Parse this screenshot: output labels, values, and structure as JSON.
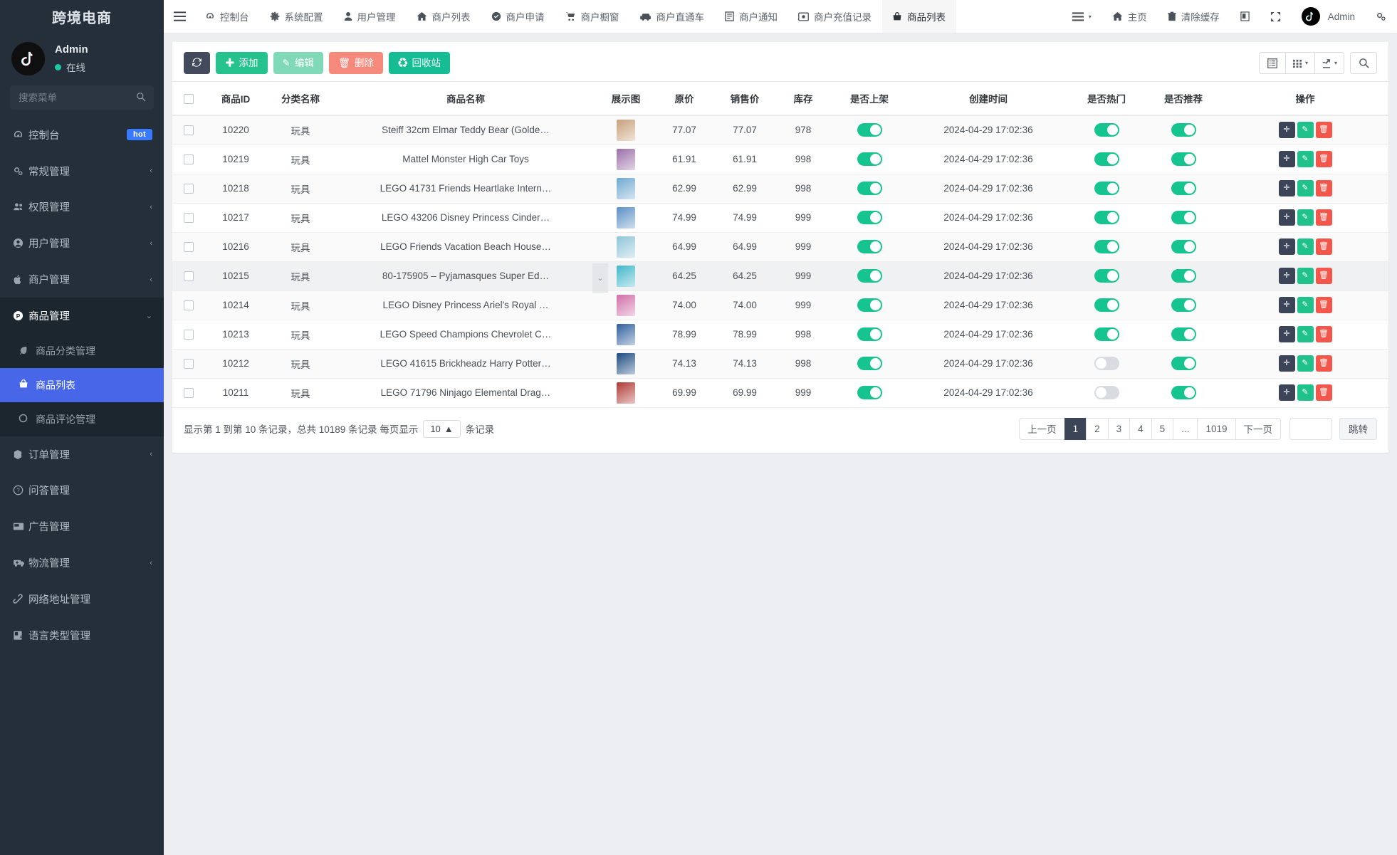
{
  "sidebar": {
    "brand": "跨境电商",
    "user": {
      "name": "Admin",
      "status": "在线",
      "avatar_icon": "tiktok-logo-icon"
    },
    "search": {
      "placeholder": "搜索菜单",
      "value": "",
      "icon": "search-icon"
    },
    "items": [
      {
        "label": "控制台",
        "icon": "dashboard-icon",
        "badge": "hot"
      },
      {
        "label": "常规管理",
        "icon": "cogs-icon",
        "arrow": "‹"
      },
      {
        "label": "权限管理",
        "icon": "users-icon",
        "arrow": "‹"
      },
      {
        "label": "用户管理",
        "icon": "user-circle-icon",
        "arrow": "‹"
      },
      {
        "label": "商户管理",
        "icon": "apple-icon",
        "arrow": "‹"
      },
      {
        "label": "商品管理",
        "icon": "product-icon",
        "arrow": "⌄"
      }
    ],
    "submenu": [
      {
        "label": "商品分类管理",
        "icon": "leaf-icon"
      },
      {
        "label": "商品列表",
        "icon": "bag-icon"
      },
      {
        "label": "商品评论管理",
        "icon": "circle-icon"
      }
    ],
    "items_after": [
      {
        "label": "订单管理",
        "icon": "cube-icon",
        "arrow": "‹"
      },
      {
        "label": "问答管理",
        "icon": "question-icon"
      },
      {
        "label": "广告管理",
        "icon": "ad-icon"
      },
      {
        "label": "物流管理",
        "icon": "truck-icon",
        "arrow": "‹"
      },
      {
        "label": "网络地址管理",
        "icon": "link-icon"
      },
      {
        "label": "语言类型管理",
        "icon": "language-icon"
      }
    ]
  },
  "topbar": {
    "hamburger_icon": "menu-icon",
    "tabs": [
      {
        "label": "控制台",
        "icon": "dashboard-icon"
      },
      {
        "label": "系统配置",
        "icon": "gear-icon"
      },
      {
        "label": "用户管理",
        "icon": "user-icon"
      },
      {
        "label": "商户列表",
        "icon": "home-icon"
      },
      {
        "label": "商户申请",
        "icon": "check-circle-icon"
      },
      {
        "label": "商户橱窗",
        "icon": "cart-icon"
      },
      {
        "label": "商户直通车",
        "icon": "car-icon"
      },
      {
        "label": "商户通知",
        "icon": "note-icon"
      },
      {
        "label": "商户充值记录",
        "icon": "money-icon"
      },
      {
        "label": "商品列表",
        "icon": "bag-icon"
      }
    ],
    "active_tab": "商品列表",
    "right": {
      "menu_label": "",
      "menu_icon": "list-icon",
      "home_label": "主页",
      "home_icon": "home-icon",
      "clear_cache_label": "清除缓存",
      "clear_cache_icon": "trash-icon",
      "note_icon": "clipboard-icon",
      "fullscreen_icon": "expand-icon",
      "admin_label": "Admin",
      "admin_avatar_icon": "tiktok-logo-icon",
      "settings_icon": "cogs-icon"
    }
  },
  "toolbar": {
    "refresh_icon": "refresh-icon",
    "refresh_label": "",
    "add_label": "添加",
    "add_icon": "plus-icon",
    "edit_label": "编辑",
    "edit_icon": "pencil-icon",
    "delete_label": "删除",
    "delete_icon": "trash-icon",
    "recycle_label": "回收站",
    "recycle_icon": "recycle-icon",
    "columns_icon": "columns-icon",
    "grid_icon": "grid-icon",
    "export_icon": "export-icon",
    "search_icon": "search-icon"
  },
  "table": {
    "columns": [
      "",
      "商品ID",
      "分类名称",
      "商品名称",
      "展示图",
      "原价",
      "销售价",
      "库存",
      "是否上架",
      "创建时间",
      "是否热门",
      "是否推荐",
      "操作"
    ],
    "rows": [
      {
        "id": "10220",
        "category": "玩具",
        "name": "Steiff 32cm Elmar Teddy Bear (Golde…",
        "price": "77.07",
        "sale_price": "77.07",
        "stock": "978",
        "on_shelf": true,
        "created": "2024-04-29 17:02:36",
        "hot": true,
        "recommend": true,
        "hovered": false,
        "thumb_color": "#c8a07a"
      },
      {
        "id": "10219",
        "category": "玩具",
        "name": "Mattel Monster High Car Toys",
        "price": "61.91",
        "sale_price": "61.91",
        "stock": "998",
        "on_shelf": true,
        "created": "2024-04-29 17:02:36",
        "hot": true,
        "recommend": true,
        "hovered": false,
        "thumb_color": "#9a6fa8"
      },
      {
        "id": "10218",
        "category": "玩具",
        "name": "LEGO 41731 Friends Heartlake Intern…",
        "price": "62.99",
        "sale_price": "62.99",
        "stock": "998",
        "on_shelf": true,
        "created": "2024-04-29 17:02:36",
        "hot": true,
        "recommend": true,
        "hovered": false,
        "thumb_color": "#6fa8d0"
      },
      {
        "id": "10217",
        "category": "玩具",
        "name": "LEGO 43206 Disney Princess Cinder…",
        "price": "74.99",
        "sale_price": "74.99",
        "stock": "999",
        "on_shelf": true,
        "created": "2024-04-29 17:02:36",
        "hot": true,
        "recommend": true,
        "hovered": false,
        "thumb_color": "#5b8fc4"
      },
      {
        "id": "10216",
        "category": "玩具",
        "name": "LEGO Friends Vacation Beach House…",
        "price": "64.99",
        "sale_price": "64.99",
        "stock": "999",
        "on_shelf": true,
        "created": "2024-04-29 17:02:36",
        "hot": true,
        "recommend": true,
        "hovered": false,
        "thumb_color": "#8fc4d8"
      },
      {
        "id": "10215",
        "category": "玩具",
        "name": "80-175905 – Pyjamasques Super Ed…",
        "price": "64.25",
        "sale_price": "64.25",
        "stock": "999",
        "on_shelf": true,
        "created": "2024-04-29 17:02:36",
        "hot": true,
        "recommend": true,
        "hovered": true,
        "thumb_color": "#3fb6c9"
      },
      {
        "id": "10214",
        "category": "玩具",
        "name": "LEGO Disney Princess Ariel's Royal …",
        "price": "74.00",
        "sale_price": "74.00",
        "stock": "999",
        "on_shelf": true,
        "created": "2024-04-29 17:02:36",
        "hot": true,
        "recommend": true,
        "hovered": false,
        "thumb_color": "#d06fa8"
      },
      {
        "id": "10213",
        "category": "玩具",
        "name": "LEGO Speed Champions Chevrolet C…",
        "price": "78.99",
        "sale_price": "78.99",
        "stock": "998",
        "on_shelf": true,
        "created": "2024-04-29 17:02:36",
        "hot": true,
        "recommend": true,
        "hovered": false,
        "thumb_color": "#2f5f9e"
      },
      {
        "id": "10212",
        "category": "玩具",
        "name": "LEGO 41615 Brickheadz Harry Potter…",
        "price": "74.13",
        "sale_price": "74.13",
        "stock": "998",
        "on_shelf": true,
        "created": "2024-04-29 17:02:36",
        "hot": false,
        "recommend": true,
        "hovered": false,
        "thumb_color": "#1c4a80"
      },
      {
        "id": "10211",
        "category": "玩具",
        "name": "LEGO 71796 Ninjago Elemental Drag…",
        "price": "69.99",
        "sale_price": "69.99",
        "stock": "999",
        "on_shelf": true,
        "created": "2024-04-29 17:02:36",
        "hot": false,
        "recommend": true,
        "hovered": false,
        "thumb_color": "#b03a34"
      }
    ],
    "row_actions": {
      "move_icon": "move-icon",
      "edit_icon": "pencil-icon",
      "delete_icon": "trash-icon"
    }
  },
  "footer": {
    "info_prefix": "显示第 1 到第 10 条记录，总共 10189 条记录 每页显示",
    "page_size": "10",
    "page_size_caret": "▲",
    "info_suffix": "条记录",
    "pager": {
      "prev": "上一页",
      "pages": [
        "1",
        "2",
        "3",
        "4",
        "5",
        "...",
        "1019"
      ],
      "active": "1",
      "next": "下一页",
      "jump_value": "",
      "jump_label": "跳转"
    }
  },
  "colors": {
    "sidebar_bg": "#242f39",
    "sidebar_active": "#4766e8",
    "accent_green": "#25c28e",
    "danger_red": "#f3564a",
    "dark_navy": "#3c4458",
    "badge_blue": "#3a7afe"
  }
}
